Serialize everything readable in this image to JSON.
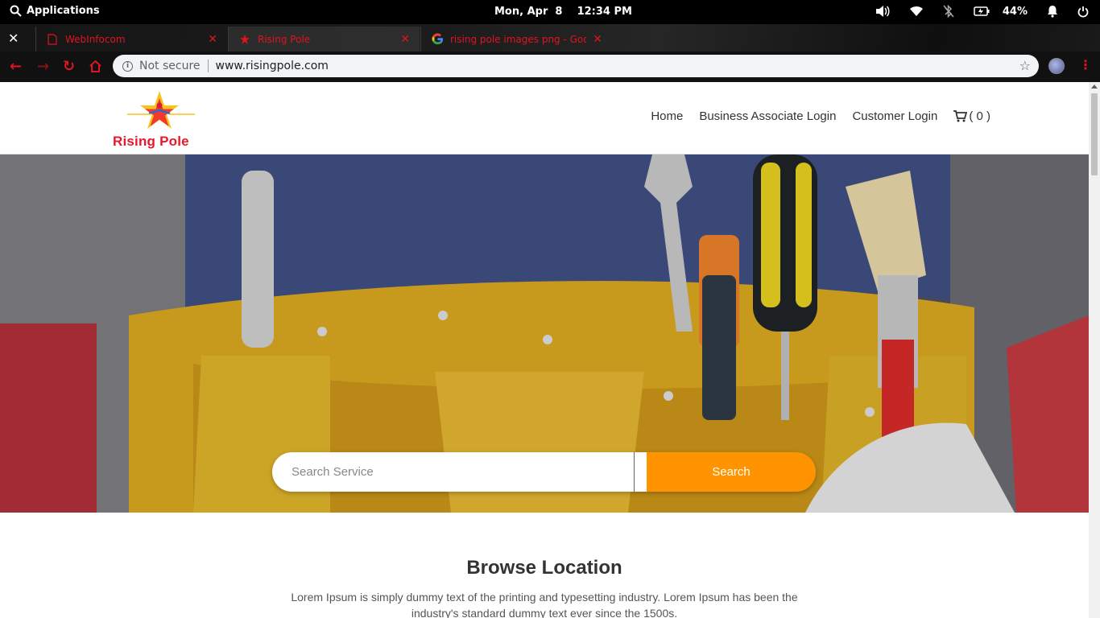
{
  "system": {
    "applications_label": "Applications",
    "datetime": "Mon, Apr  8    12:34 PM",
    "battery": "44%"
  },
  "browser": {
    "tabs": [
      {
        "title": "WebInfocom",
        "active": false
      },
      {
        "title": "Rising Pole",
        "active": true
      },
      {
        "title": "rising pole images png - Google",
        "active": false
      }
    ],
    "address": {
      "security": "Not secure",
      "url": "www.risingpole.com"
    }
  },
  "site": {
    "logo_text": "Rising Pole",
    "nav": {
      "home": "Home",
      "business_login": "Business Associate Login",
      "customer_login": "Customer Login",
      "cart": "( 0 )"
    },
    "search": {
      "placeholder": "Search Service",
      "button": "Search"
    },
    "browse": {
      "title": "Browse Location",
      "text": "Lorem Ipsum is simply dummy text of the printing and typesetting industry. Lorem Ipsum has been the industry's standard dummy text ever since the 1500s."
    }
  },
  "colors": {
    "accent_orange": "#ff9400",
    "brand_red": "#e8172b",
    "browser_red": "#e0141e"
  }
}
